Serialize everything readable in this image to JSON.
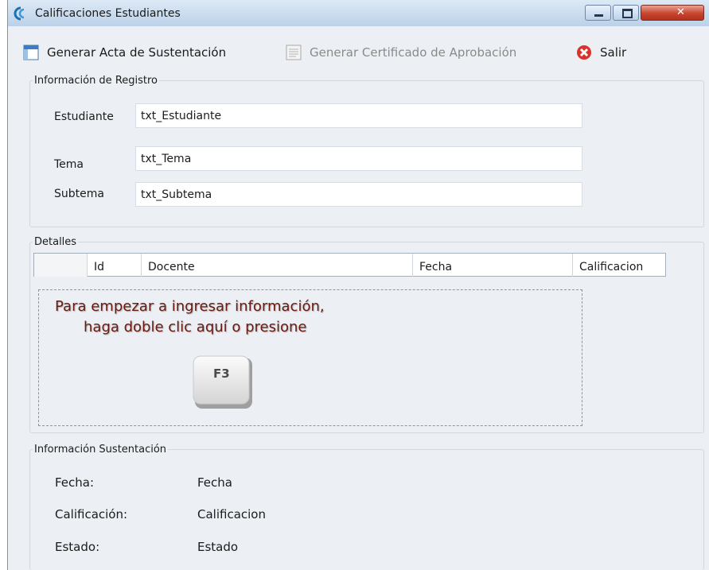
{
  "window": {
    "title": "Calificaciones Estudiantes"
  },
  "toolbar": {
    "acta_label": "Generar Acta de Sustentación",
    "certificado_label": "Generar Certificado de Aprobación",
    "salir_label": "Salir"
  },
  "registro": {
    "group_label": "Información de Registro",
    "estudiante_label": "Estudiante",
    "estudiante_value": "txt_Estudiante",
    "tema_label": "Tema",
    "tema_value": "txt_Tema",
    "subtema_label": "Subtema",
    "subtema_value": "txt_Subtema"
  },
  "detalles": {
    "group_label": "Detalles",
    "columns": [
      "",
      "Id",
      "Docente",
      "Fecha",
      "Calificacion"
    ],
    "hint_line1": "Para empezar a ingresar información,",
    "hint_line2": "haga doble clic aquí o presione",
    "key_label": "F3"
  },
  "sustentacion": {
    "group_label": "Información Sustentación",
    "fecha_label": "Fecha:",
    "fecha_value": "Fecha",
    "calificacion_label": "Calificación:",
    "calificacion_value": "Calificacion",
    "estado_label": "Estado:",
    "estado_value": "Estado"
  },
  "colors": {
    "close_button": "#c7452e",
    "hint_text": "#6b1a12",
    "window_bg": "#ecf0f4"
  }
}
